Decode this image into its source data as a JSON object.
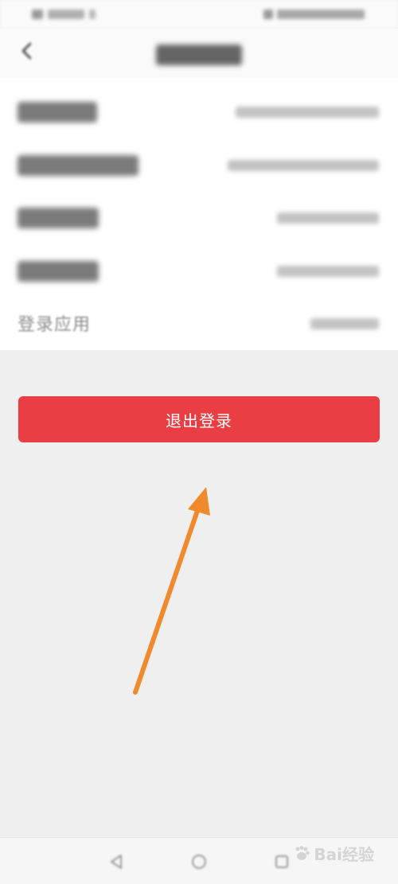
{
  "status_bar": {
    "left_text": "",
    "right_text": ""
  },
  "header": {
    "back_icon": "chevron-left-icon",
    "title": ""
  },
  "details": {
    "rows": [
      {
        "label": "",
        "value": ""
      },
      {
        "label": "",
        "value": ""
      },
      {
        "label": "",
        "value": ""
      },
      {
        "label": "",
        "value": ""
      },
      {
        "label": "登录应用",
        "value": ""
      }
    ]
  },
  "logout": {
    "label": "退出登录",
    "color": "#ea3e45"
  },
  "annotation": {
    "arrow_color": "#f08a2c"
  },
  "nav": {
    "icons": [
      "back-triangle-icon",
      "home-circle-icon",
      "recents-square-icon"
    ]
  },
  "watermark": {
    "text": "Bai经验"
  }
}
